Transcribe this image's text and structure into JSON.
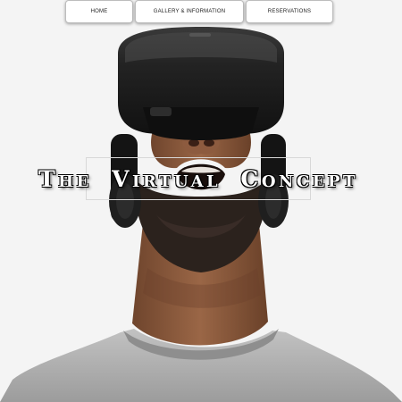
{
  "nav": {
    "home": "HOME",
    "gallery": "GALLERY & INFORMATION",
    "reservations": "RESERVATIONS"
  },
  "hero": {
    "title": "The Virtual Concept",
    "image_subject": "man-wearing-vr-headset"
  },
  "colors": {
    "background": "#f4f4f4",
    "headset": "#1c1c1c",
    "skin": "#8a5a3e",
    "beard": "#2a221e",
    "shirt": "#a9a9a9",
    "title_text": "#ffffff"
  }
}
